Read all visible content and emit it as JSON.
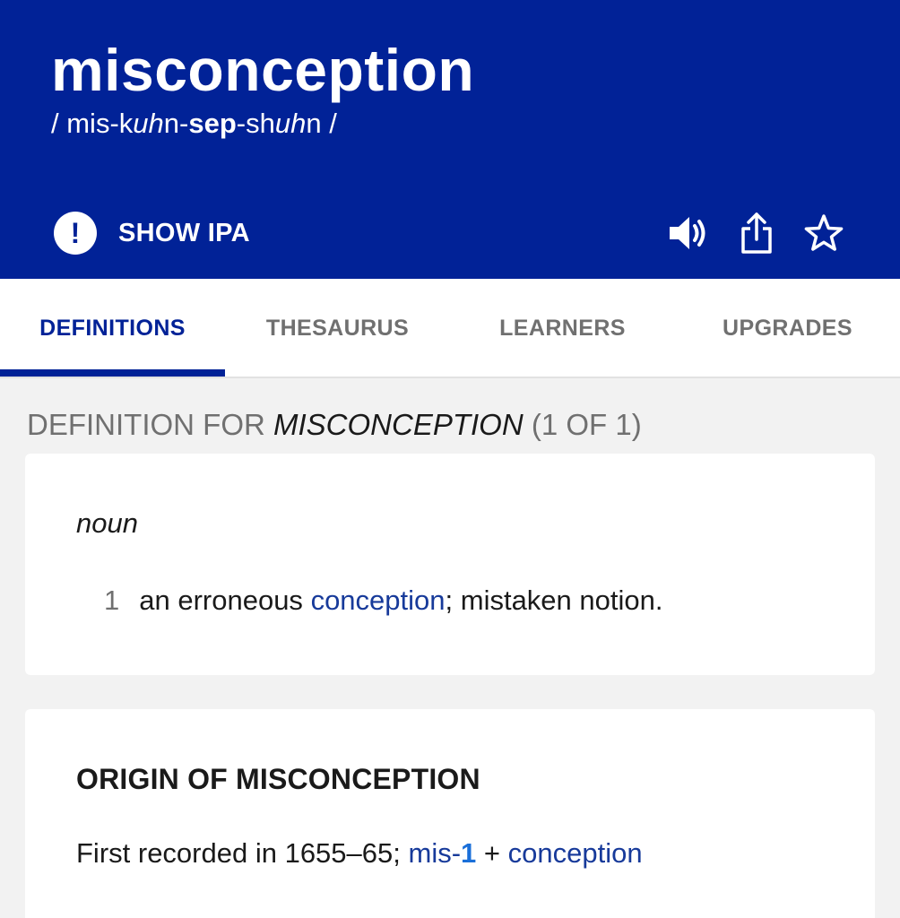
{
  "header": {
    "headword": "misconception",
    "pronunciation": {
      "slash_open": "/",
      "p1": " mis-k",
      "p2": "uh",
      "p3": "n-",
      "p4": "sep",
      "p5": "-sh",
      "p6": "uh",
      "p7": "n",
      "slash_close": "/"
    },
    "show_ipa_label": "SHOW IPA",
    "show_ipa_icon": "exclamation-circle-icon",
    "icons": [
      "speaker-icon",
      "share-icon",
      "star-icon"
    ],
    "background_color": "#012297"
  },
  "tabs": {
    "items": [
      {
        "label": "DEFINITIONS",
        "active": true
      },
      {
        "label": "THESAURUS",
        "active": false
      },
      {
        "label": "LEARNERS",
        "active": false
      },
      {
        "label": "UPGRADES",
        "active": false
      }
    ]
  },
  "definition": {
    "heading_prefix": "DEFINITION FOR ",
    "heading_word": "MISCONCEPTION",
    "heading_count": " (1 OF 1)",
    "part_of_speech": "noun",
    "senses": [
      {
        "number": "1",
        "text_before": "an erroneous ",
        "link": "conception",
        "text_after": ";  mistaken notion."
      }
    ]
  },
  "origin": {
    "title": "ORIGIN OF MISCONCEPTION",
    "text_before": "First recorded in 1655–65; ",
    "link1": "mis-",
    "link1_number": "1",
    "connector": " + ",
    "link2": "conception"
  },
  "colors": {
    "accent": "#012297",
    "link": "#173a9a",
    "muted": "#707070",
    "page_background": "#f2f2f2"
  }
}
